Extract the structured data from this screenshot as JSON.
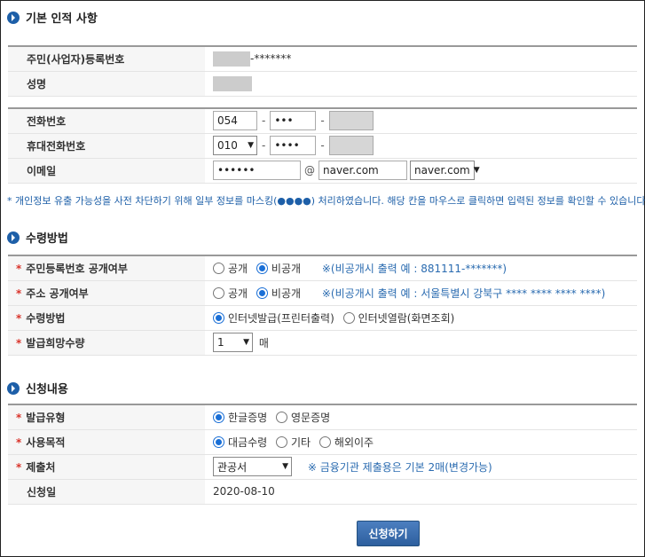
{
  "sections": {
    "basic_title": "기본 인적 사항",
    "receipt_title": "수령방법",
    "request_title": "신청내용"
  },
  "basic": {
    "rrn_label": "주민(사업자)등록번호",
    "rrn_suffix": "-*******",
    "name_label": "성명",
    "phone_label": "전화번호",
    "phone_area": "054",
    "phone_mid": "•••",
    "mobile_label": "휴대전화번호",
    "mobile_prefix": "010",
    "mobile_mid": "••••",
    "email_label": "이메일",
    "email_id": "••••••",
    "email_at": "@",
    "email_domain": "naver.com",
    "email_domain_select": "naver.com",
    "dash": "-"
  },
  "notice": "* 개인정보 유출 가능성을 사전 차단하기 위해 일부 정보를 마스킹(●●●●) 처리하였습니다. 해당 칸을 마우스로 클릭하면 입력된 정보를 확인할 수 있습니다.",
  "receipt": {
    "rrn_public_label": "주민등록번호 공개여부",
    "addr_public_label": "주소 공개여부",
    "method_label": "수령방법",
    "qty_label": "발급희망수량",
    "public": "공개",
    "private": "비공개",
    "rrn_note": "※(비공개시 출력 예 : 881111-*******)",
    "addr_note": "※(비공개시 출력 예 : 서울특별시 강북구 **** **** **** ****)",
    "method_internet_print": "인터넷발급(프린터출력)",
    "method_internet_view": "인터넷열람(화면조회)",
    "qty_value": "1",
    "qty_unit": "매"
  },
  "request": {
    "type_label": "발급유형",
    "type_korean": "한글증명",
    "type_english": "영문증명",
    "purpose_label": "사용목적",
    "purpose_loan": "대금수령",
    "purpose_other": "기타",
    "purpose_abroad": "해외이주",
    "submit_to_label": "제출처",
    "submit_to_value": "관공서",
    "submit_note": "※ 금융기관 제출용은 기본 2매(변경가능)",
    "date_label": "신청일",
    "date_value": "2020-08-10"
  },
  "submit_button": "신청하기",
  "required_mark": "*",
  "colors": {
    "accent": "#1d5fa8",
    "required": "#d9342b",
    "note": "#2a6bb0"
  }
}
